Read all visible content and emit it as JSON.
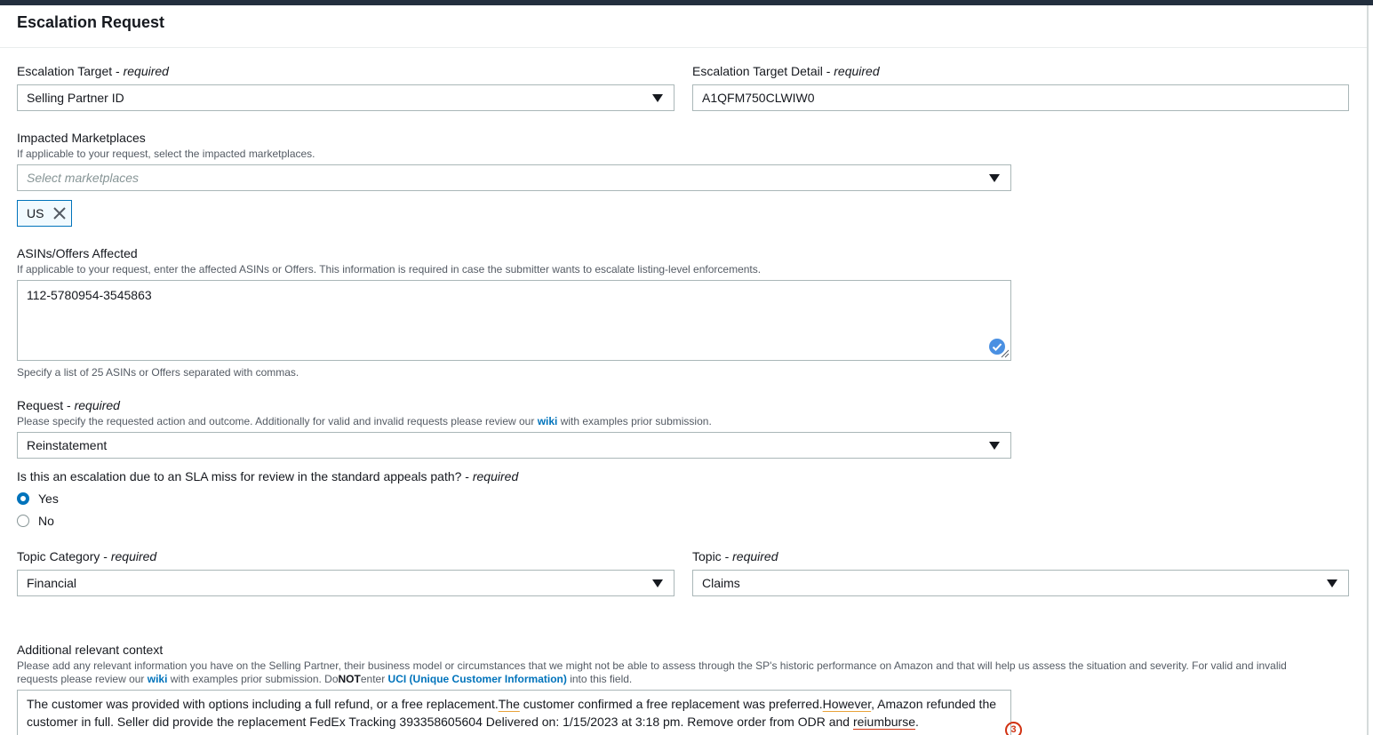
{
  "page": {
    "title": "Escalation Request"
  },
  "escalation_target": {
    "label": "Escalation Target - ",
    "required": "required",
    "value": "Selling Partner ID"
  },
  "escalation_target_detail": {
    "label": "Escalation Target Detail - ",
    "required": "required",
    "value": "A1QFM750CLWIW0"
  },
  "impacted_marketplaces": {
    "label": "Impacted Marketplaces",
    "description": "If applicable to your request, select the impacted marketplaces.",
    "placeholder": "Select marketplaces",
    "tokens": [
      "US"
    ]
  },
  "asins": {
    "label": "ASINs/Offers Affected",
    "description": "If applicable to your request, enter the affected ASINs or Offers. This information is required in case the submitter wants to escalate listing-level enforcements.",
    "value": "112-5780954-3545863",
    "hint": "Specify a list of 25 ASINs or Offers separated with commas."
  },
  "request": {
    "label": "Request - ",
    "required": "required",
    "description_pre": "Please specify the requested action and outcome. Additionally for valid and invalid requests please review our ",
    "wiki_link": "wiki",
    "description_post": " with examples prior submission.",
    "value": "Reinstatement"
  },
  "sla_question": {
    "label": "Is this an escalation due to an SLA miss for review in the standard appeals path? - ",
    "required": "required",
    "options": [
      {
        "label": "Yes",
        "selected": true
      },
      {
        "label": "No",
        "selected": false
      }
    ]
  },
  "topic_category": {
    "label": "Topic Category - ",
    "required": "required",
    "value": "Financial"
  },
  "topic": {
    "label": "Topic - ",
    "required": "required",
    "value": "Claims"
  },
  "additional_context": {
    "label": "Additional relevant context",
    "description_line1": "Please add any relevant information you have on the Selling Partner, their business model or circumstances that we might not be able to assess through the SP's historic performance on Amazon and that will help us assess the situation and severity. For valid and invalid",
    "description_line2_pre": "requests please review our ",
    "wiki_link": "wiki",
    "description_line2_mid": " with examples prior submission. Do",
    "not_text": "NOT",
    "enter_text": "enter ",
    "uci_link": "UCI (Unique Customer Information)",
    "description_line2_post": " into this field.",
    "text_part1": "The customer was provided with options including a full refund, or a free replacement.",
    "text_the": "The",
    "text_part2": " customer confirmed a free replacement was preferred.",
    "text_however": "However",
    "text_part3": ", Amazon refunded the customer in full. Seller did provide the replacement FedEx Tracking 393358605604 Delivered on:  1/15/2023 at 3:18 pm. Remove order from ODR and ",
    "text_misspelled": "reiumburse",
    "text_end": ".",
    "issue_count": "3"
  },
  "colors": {
    "accent": "#0073bb",
    "topbar": "#232f3e",
    "error": "#d13212",
    "warning": "#e8a33a"
  }
}
